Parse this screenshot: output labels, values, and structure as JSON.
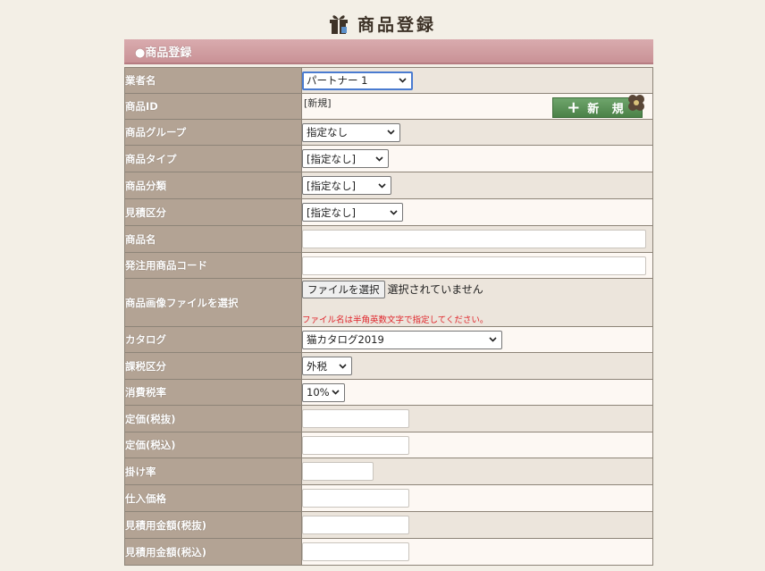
{
  "page_title": "商品登録",
  "section_title": "●商品登録",
  "fields": {
    "vendor": {
      "label": "業者名",
      "value": "パートナー 1"
    },
    "product_id": {
      "label": "商品ID",
      "value": "[新規]",
      "new_button": "新 規"
    },
    "group": {
      "label": "商品グループ",
      "value": "指定なし"
    },
    "type": {
      "label": "商品タイプ",
      "value": "[指定なし]"
    },
    "category": {
      "label": "商品分類",
      "value": "[指定なし]"
    },
    "estimate_class": {
      "label": "見積区分",
      "value": "[指定なし]"
    },
    "name": {
      "label": "商品名",
      "value": ""
    },
    "order_code": {
      "label": "発注用商品コード",
      "value": ""
    },
    "image_file": {
      "label": "商品画像ファイルを選択",
      "button": "ファイルを選択",
      "status": "選択されていません",
      "note": "ファイル名は半角英数文字で指定してください。"
    },
    "catalog": {
      "label": "カタログ",
      "value": "猫カタログ2019"
    },
    "tax_class": {
      "label": "課税区分",
      "value": "外税"
    },
    "tax_rate": {
      "label": "消費税率",
      "value": "10%"
    },
    "list_price_ex": {
      "label": "定価(税抜)",
      "value": ""
    },
    "list_price_in": {
      "label": "定価(税込)",
      "value": ""
    },
    "rate": {
      "label": "掛け率",
      "value": ""
    },
    "purchase_price": {
      "label": "仕入価格",
      "value": ""
    },
    "estimate_price_ex": {
      "label": "見積用金額(税抜)",
      "value": ""
    },
    "estimate_price_in": {
      "label": "見積用金額(税込)",
      "value": ""
    }
  },
  "colors": {
    "label_bg": "#b3a394",
    "header_bg": "#c99296",
    "new_button_bg": "#4a8147",
    "warning_text": "#e0242a"
  },
  "icons": [
    "gift-icon",
    "plus-icon",
    "flower-icon",
    "chevron-down-icon"
  ]
}
